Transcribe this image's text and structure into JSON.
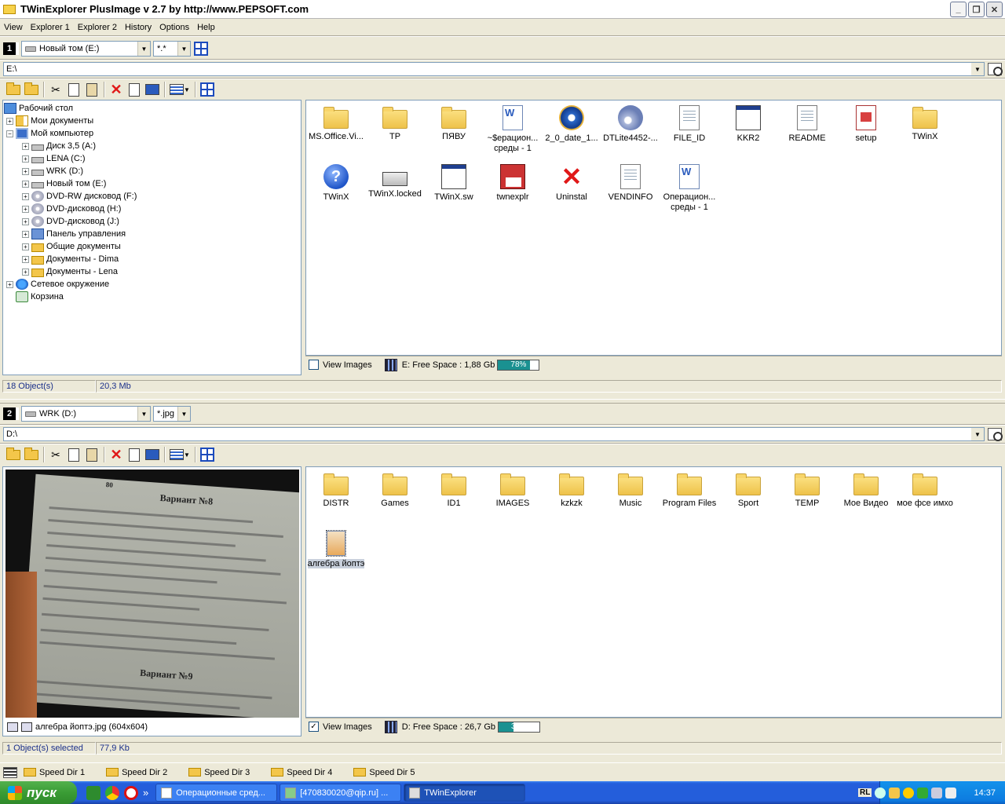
{
  "window": {
    "title": "TWinExplorer PlusImage v 2.7 by http://www.PEPSOFT.com"
  },
  "menu": [
    "View",
    "Explorer 1",
    "Explorer 2",
    "History",
    "Options",
    "Help"
  ],
  "panel1": {
    "number": "1",
    "drive": "Новый том (E:)",
    "filter": "*.*",
    "path": "E:\\",
    "tree": [
      {
        "label": "Рабочий стол",
        "icon": "desktop-icon",
        "level": 0,
        "exp": ""
      },
      {
        "label": "Мои документы",
        "icon": "my-documents-icon",
        "level": 1,
        "exp": "+"
      },
      {
        "label": "Мой компьютер",
        "icon": "my-computer-icon",
        "level": 1,
        "exp": "−"
      },
      {
        "label": "Диск 3,5 (A:)",
        "icon": "floppy-drive-icon",
        "level": 2,
        "exp": "+"
      },
      {
        "label": "LENA (C:)",
        "icon": "drive-icon",
        "level": 2,
        "exp": "+"
      },
      {
        "label": "WRK (D:)",
        "icon": "drive-icon",
        "level": 2,
        "exp": "+"
      },
      {
        "label": "Новый том (E:)",
        "icon": "drive-icon",
        "level": 2,
        "exp": "+"
      },
      {
        "label": "DVD-RW дисковод (F:)",
        "icon": "cd-drive-icon",
        "level": 2,
        "exp": "+"
      },
      {
        "label": "DVD-дисковод (H:)",
        "icon": "cd-drive-icon",
        "level": 2,
        "exp": "+"
      },
      {
        "label": "DVD-дисковод (J:)",
        "icon": "cd-drive-icon",
        "level": 2,
        "exp": "+"
      },
      {
        "label": "Панель управления",
        "icon": "control-panel-icon",
        "level": 2,
        "exp": "+"
      },
      {
        "label": "Общие документы",
        "icon": "folder-icon",
        "level": 2,
        "exp": "+"
      },
      {
        "label": "Документы - Dima",
        "icon": "folder-icon",
        "level": 2,
        "exp": "+"
      },
      {
        "label": "Документы - Lena",
        "icon": "folder-icon",
        "level": 2,
        "exp": "+"
      },
      {
        "label": "Сетевое окружение",
        "icon": "network-icon",
        "level": 1,
        "exp": "+"
      },
      {
        "label": "Корзина",
        "icon": "recycle-bin-icon",
        "level": 1,
        "exp": ""
      }
    ],
    "files": [
      {
        "name": "MS.Office.Vi...",
        "type": "folder"
      },
      {
        "name": "TP",
        "type": "folder"
      },
      {
        "name": "ПЯВУ",
        "type": "folder"
      },
      {
        "name": "~$ерацион... среды - 1",
        "type": "word"
      },
      {
        "name": "2_0_date_1...",
        "type": "media"
      },
      {
        "name": "DTLite4452-...",
        "type": "cd"
      },
      {
        "name": "FILE_ID",
        "type": "doc"
      },
      {
        "name": "KKR2",
        "type": "app"
      },
      {
        "name": "README",
        "type": "doc"
      },
      {
        "name": "setup",
        "type": "setup"
      },
      {
        "name": "TWinX",
        "type": "folder"
      },
      {
        "name": "TWinX",
        "type": "help"
      },
      {
        "name": "TWinX.locked",
        "type": "printer"
      },
      {
        "name": "TWinX.sw",
        "type": "app"
      },
      {
        "name": "twnexplr",
        "type": "floppy"
      },
      {
        "name": "Uninstal",
        "type": "x"
      },
      {
        "name": "VENDINFO",
        "type": "doc"
      },
      {
        "name": "Операцион... среды - 1",
        "type": "word"
      }
    ],
    "view_images_label": "View Images",
    "view_images_checked": false,
    "free_space": "E: Free Space : 1,88 Gb",
    "used_pct": 78,
    "used_label": "78%",
    "status_objects": "18 Object(s)",
    "status_size": "20,3 Mb"
  },
  "panel2": {
    "number": "2",
    "drive": "WRK (D:)",
    "filter": "*.jpg",
    "path": "D:\\",
    "files": [
      {
        "name": "DISTR",
        "type": "folder"
      },
      {
        "name": "Games",
        "type": "folder"
      },
      {
        "name": "ID1",
        "type": "folder"
      },
      {
        "name": "IMAGES",
        "type": "folder"
      },
      {
        "name": "kzkzk",
        "type": "folder"
      },
      {
        "name": "Music",
        "type": "folder"
      },
      {
        "name": "Program Files",
        "type": "folder"
      },
      {
        "name": "Sport",
        "type": "folder"
      },
      {
        "name": "TEMP",
        "type": "folder"
      },
      {
        "name": "Мое Видео",
        "type": "folder"
      },
      {
        "name": "мое фсе имхо",
        "type": "folder"
      },
      {
        "name": "алгебра йоптэ",
        "type": "img",
        "selected": true
      }
    ],
    "image_caption": "алгебра йоптэ.jpg (604x604)",
    "image_text": {
      "page_num": "80",
      "variant8": "Вариант №8",
      "variant9": "Вариант №9"
    },
    "view_images_label": "View Images",
    "view_images_checked": true,
    "free_space": "D: Free Space : 26,7 Gb",
    "used_pct": 37,
    "used_label": "37%",
    "status_objects": "1 Object(s) selected",
    "status_size": "77,9 Kb"
  },
  "speed_dirs": [
    "Speed Dir 1",
    "Speed Dir 2",
    "Speed Dir 3",
    "Speed Dir 4",
    "Speed Dir 5"
  ],
  "taskbar": {
    "start_label": "пуск",
    "quicklaunch_more": "»",
    "tasks": [
      {
        "label": "Операционные сред...",
        "active": false
      },
      {
        "label": "[470830020@qip.ru] ...",
        "active": false
      },
      {
        "label": "TWinExplorer",
        "active": true
      }
    ],
    "lang": "RL",
    "clock": "14:37"
  },
  "colors": {
    "space_fill": "#1a9191",
    "taskbar": "#245edb",
    "start": "#3a9c35"
  }
}
